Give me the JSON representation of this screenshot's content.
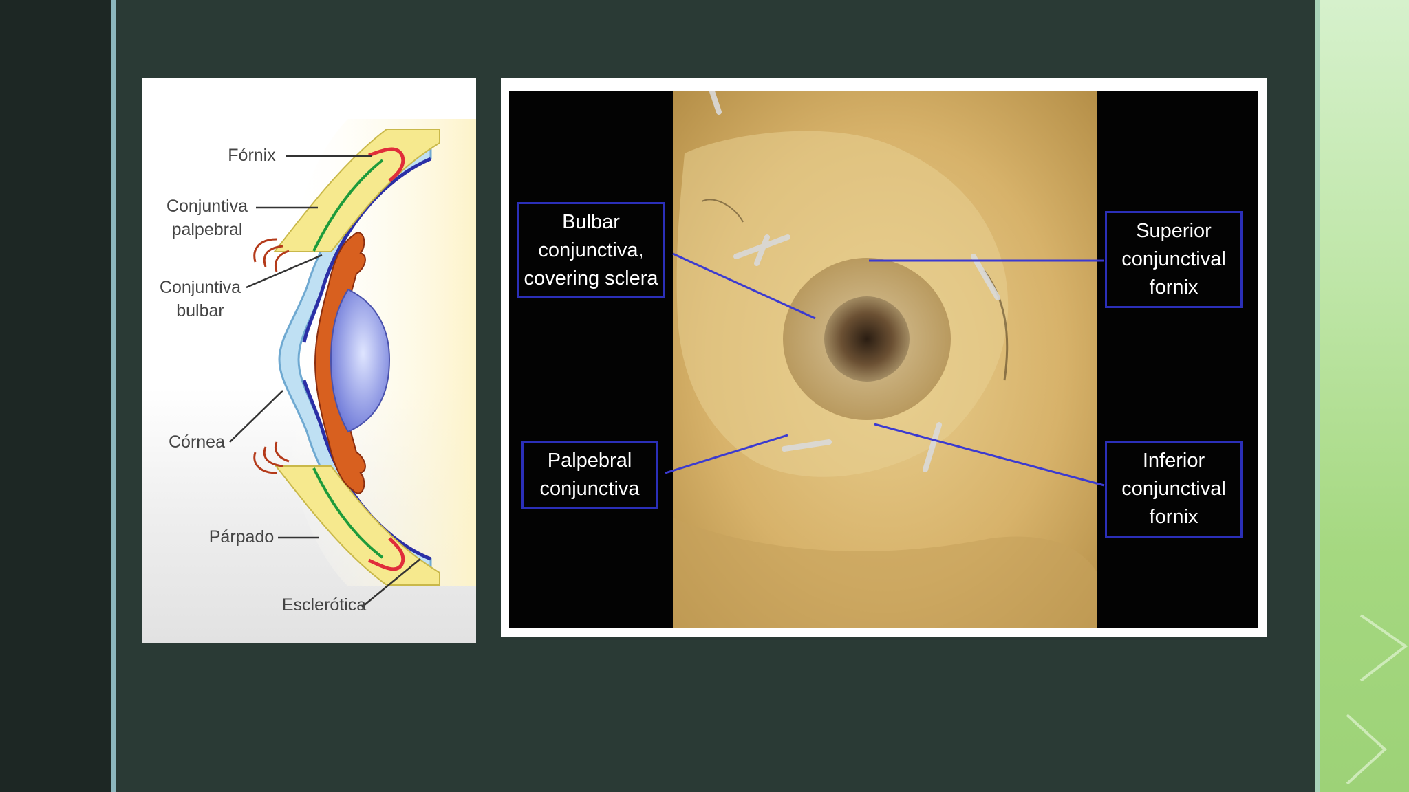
{
  "diagram": {
    "labels": {
      "fornix": "Fórnix",
      "conjuntiva_palpebral": "Conjuntiva\npalpebral",
      "conjuntiva_bulbar": "Conjuntiva\nbulbar",
      "cornea": "Córnea",
      "parpado": "Párpado",
      "esclerotica": "Esclerótica"
    }
  },
  "photo": {
    "labels": {
      "bulbar": "Bulbar\nconjunctiva,\ncovering sclera",
      "superior_fornix": "Superior\nconjunctival\nfornix",
      "palpebral": "Palpebral\nconjunctiva",
      "inferior_fornix": "Inferior\nconjunctival\nfornix"
    }
  },
  "colors": {
    "label_border": "#2b2fb8",
    "slide_background": "#2a3a35",
    "accent_band": "#a5d880"
  }
}
